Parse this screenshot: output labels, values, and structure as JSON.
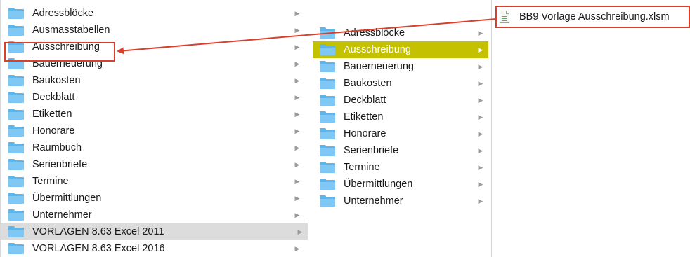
{
  "columns": [
    {
      "items": [
        {
          "label": "Adressblöcke",
          "state": "normal"
        },
        {
          "label": "Ausmasstabellen",
          "state": "normal"
        },
        {
          "label": "Ausschreibung",
          "state": "normal"
        },
        {
          "label": "Bauerneuerung",
          "state": "normal"
        },
        {
          "label": "Baukosten",
          "state": "normal"
        },
        {
          "label": "Deckblatt",
          "state": "normal"
        },
        {
          "label": "Etiketten",
          "state": "normal"
        },
        {
          "label": "Honorare",
          "state": "normal"
        },
        {
          "label": "Raumbuch",
          "state": "normal"
        },
        {
          "label": "Serienbriefe",
          "state": "normal"
        },
        {
          "label": "Termine",
          "state": "normal"
        },
        {
          "label": "Übermittlungen",
          "state": "normal"
        },
        {
          "label": "Unternehmer",
          "state": "normal"
        },
        {
          "label": "VORLAGEN 8.63 Excel 2011",
          "state": "selected-inactive"
        },
        {
          "label": "VORLAGEN 8.63 Excel 2016",
          "state": "normal"
        }
      ]
    },
    {
      "items": [
        {
          "label": "Adressblöcke",
          "state": "normal"
        },
        {
          "label": "Ausschreibung",
          "state": "selected-active"
        },
        {
          "label": "Bauerneuerung",
          "state": "normal"
        },
        {
          "label": "Baukosten",
          "state": "normal"
        },
        {
          "label": "Deckblatt",
          "state": "normal"
        },
        {
          "label": "Etiketten",
          "state": "normal"
        },
        {
          "label": "Honorare",
          "state": "normal"
        },
        {
          "label": "Serienbriefe",
          "state": "normal"
        },
        {
          "label": "Termine",
          "state": "normal"
        },
        {
          "label": "Übermittlungen",
          "state": "normal"
        },
        {
          "label": "Unternehmer",
          "state": "normal"
        }
      ]
    },
    {
      "items": [
        {
          "label": "BB9 Vorlage Ausschreibung.xlsm",
          "icon": "excel-document-icon"
        }
      ]
    }
  ],
  "icons": {
    "folder": "folder-icon",
    "chevron": "chevron-right-icon",
    "file": "excel-document-icon"
  },
  "chevron_glyph": "▶",
  "colors": {
    "folder_blue": "#5cb6ee",
    "selection_yellow": "#c4c200",
    "selection_gray": "#dcdcdc",
    "annotation_red": "#d9402c"
  }
}
